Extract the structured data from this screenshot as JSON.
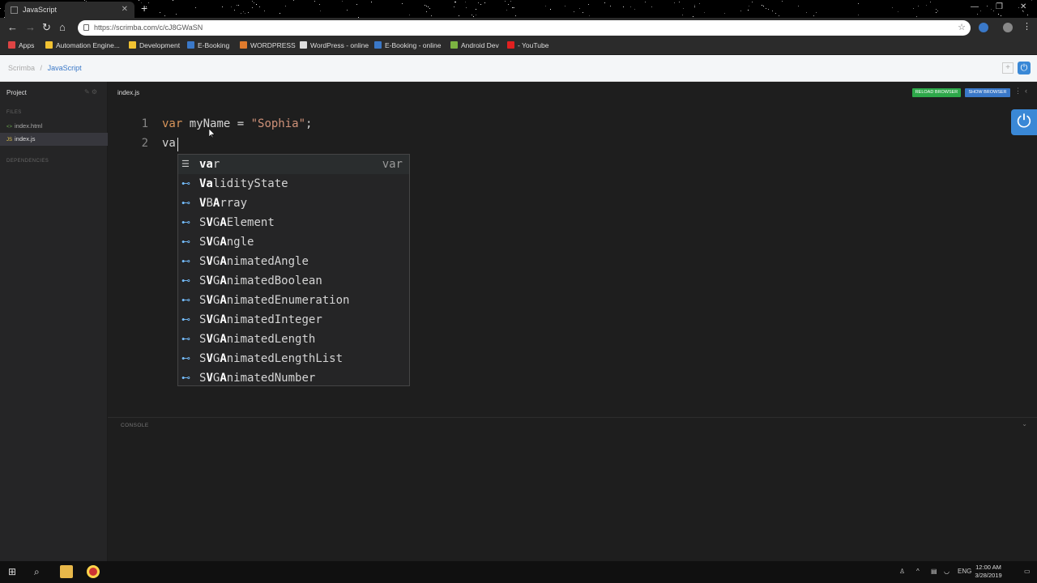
{
  "browser": {
    "tab_title": "JavaScript",
    "new_tab": "+",
    "url": "https://scrimba.com/c/cJ8GWaSN",
    "bookmarks": [
      {
        "label": "Apps",
        "color": "#d44"
      },
      {
        "label": "Automation Engine...",
        "color": "#f1c232"
      },
      {
        "label": "Development",
        "color": "#f1c232"
      },
      {
        "label": "E-Booking",
        "color": "#3a78c8"
      },
      {
        "label": "WORDPRESS",
        "color": "#e07b2d"
      },
      {
        "label": "WordPress - online",
        "color": "#dddddd"
      },
      {
        "label": "E-Booking - online",
        "color": "#3a78c8"
      },
      {
        "label": "Android Dev",
        "color": "#7cb342"
      },
      {
        "label": "- YouTube",
        "color": "#e02020"
      }
    ]
  },
  "header": {
    "breadcrumb_root": "Scrimba",
    "breadcrumb_sep": "/",
    "breadcrumb_current": "JavaScript"
  },
  "sidebar": {
    "title": "Project",
    "files_label": "FILES",
    "files": [
      {
        "icon": "<>",
        "name": "index.html"
      },
      {
        "icon": "JS",
        "name": "index.js"
      }
    ],
    "dependencies_label": "DEPENDENCIES"
  },
  "editor": {
    "active_file": "index.js",
    "reload_button": "RELOAD BROWSER",
    "show_button": "SHOW BROWSER",
    "lines": [
      {
        "num": "1",
        "kw": "var",
        "rest_before": " myName = ",
        "str": "\"Sophia\"",
        "rest_after": ";"
      },
      {
        "num": "2",
        "text": "va"
      }
    ]
  },
  "suggestions": [
    {
      "match": "va",
      "rest": "r",
      "detail": "var",
      "kind": "keyword"
    },
    {
      "match": "Va",
      "rest": "lidityState",
      "detail": "",
      "kind": "property"
    },
    {
      "pre": "",
      "match": "V",
      "mid": "B",
      "match2": "A",
      "rest": "rray",
      "detail": "",
      "kind": "property"
    },
    {
      "pre": "S",
      "match": "V",
      "mid": "G",
      "match2": "A",
      "rest": "Element",
      "detail": "",
      "kind": "property"
    },
    {
      "pre": "S",
      "match": "V",
      "mid": "G",
      "match2": "A",
      "rest": "ngle",
      "detail": "",
      "kind": "property"
    },
    {
      "pre": "S",
      "match": "V",
      "mid": "G",
      "match2": "A",
      "rest": "nimatedAngle",
      "detail": "",
      "kind": "property"
    },
    {
      "pre": "S",
      "match": "V",
      "mid": "G",
      "match2": "A",
      "rest": "nimatedBoolean",
      "detail": "",
      "kind": "property"
    },
    {
      "pre": "S",
      "match": "V",
      "mid": "G",
      "match2": "A",
      "rest": "nimatedEnumeration",
      "detail": "",
      "kind": "property"
    },
    {
      "pre": "S",
      "match": "V",
      "mid": "G",
      "match2": "A",
      "rest": "nimatedInteger",
      "detail": "",
      "kind": "property"
    },
    {
      "pre": "S",
      "match": "V",
      "mid": "G",
      "match2": "A",
      "rest": "nimatedLength",
      "detail": "",
      "kind": "property"
    },
    {
      "pre": "S",
      "match": "V",
      "mid": "G",
      "match2": "A",
      "rest": "nimatedLengthList",
      "detail": "",
      "kind": "property"
    },
    {
      "pre": "S",
      "match": "V",
      "mid": "G",
      "match2": "A",
      "rest": "nimatedNumber",
      "detail": "",
      "kind": "property"
    }
  ],
  "console": {
    "label": "CONSOLE"
  },
  "taskbar": {
    "lang": "ENG",
    "time": "12:00 AM",
    "date": "3/28/2019"
  }
}
